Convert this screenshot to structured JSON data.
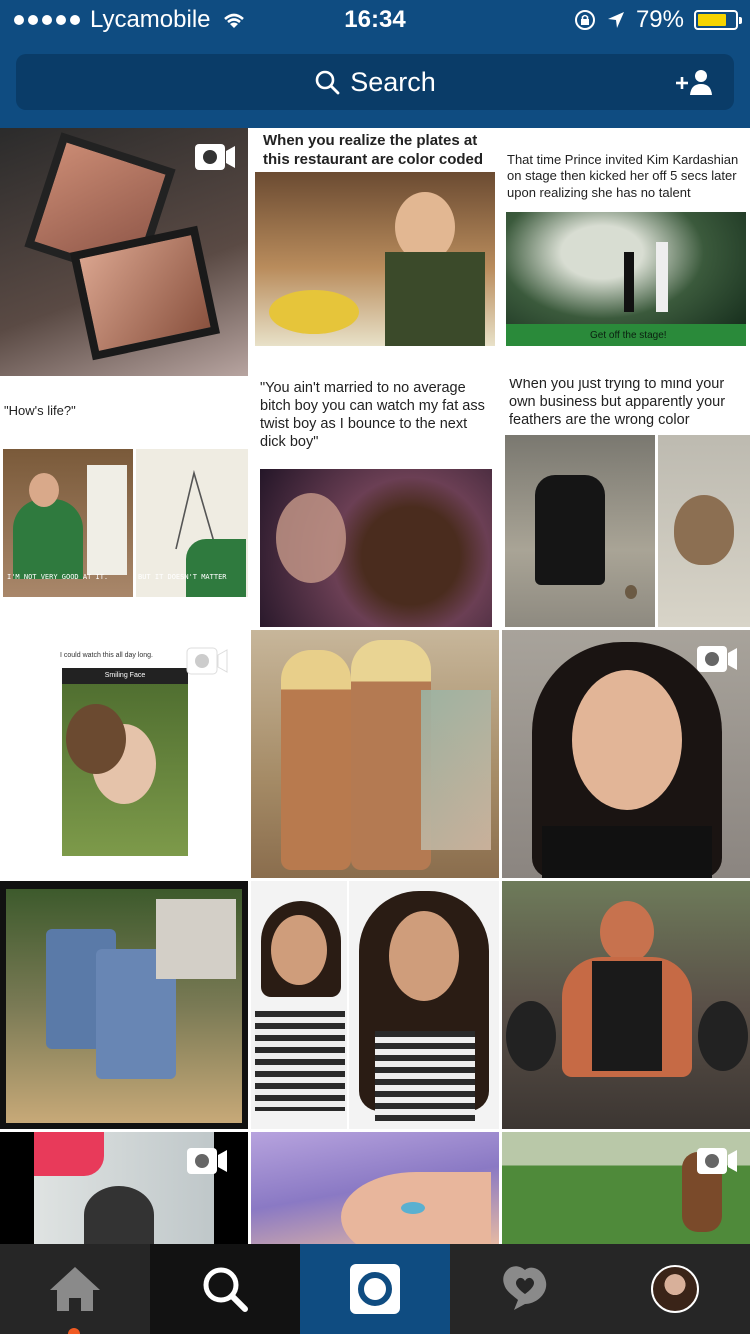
{
  "status_bar": {
    "carrier": "Lycamobile",
    "time": "16:34",
    "battery": "79%",
    "battery_level": 0.79
  },
  "search": {
    "placeholder": "Search"
  },
  "captions": {
    "plates": "When you realize the plates at this restaurant are color coded",
    "prince": "That time Prince invited Kim Kardashian on stage then kicked her off 5 secs later upon realizing she has no talent",
    "prince_sub": "Get off the stage!",
    "hows_life": "\"How's life?\"",
    "not_good": "I'M NOT VERY GOOD AT IT.",
    "doesnt_matter": "BUT IT DOESN'T MATTER",
    "married": "\"You ain't married to no average bitch boy you can watch my fat ass twist boy as I bounce to the next dick boy\"",
    "feathers": "When you just trying to mind your own business but apparently your feathers are the wrong color",
    "watch_all_day": "I could watch this all day long.",
    "smiling_face": "Smiling Face"
  },
  "tabs": [
    "home",
    "search",
    "camera",
    "activity",
    "profile"
  ],
  "colors": {
    "brand": "#0f4c81",
    "tabbar": "#262626",
    "notification_dot": "#f05a22",
    "battery_fill": "#f5d400"
  }
}
